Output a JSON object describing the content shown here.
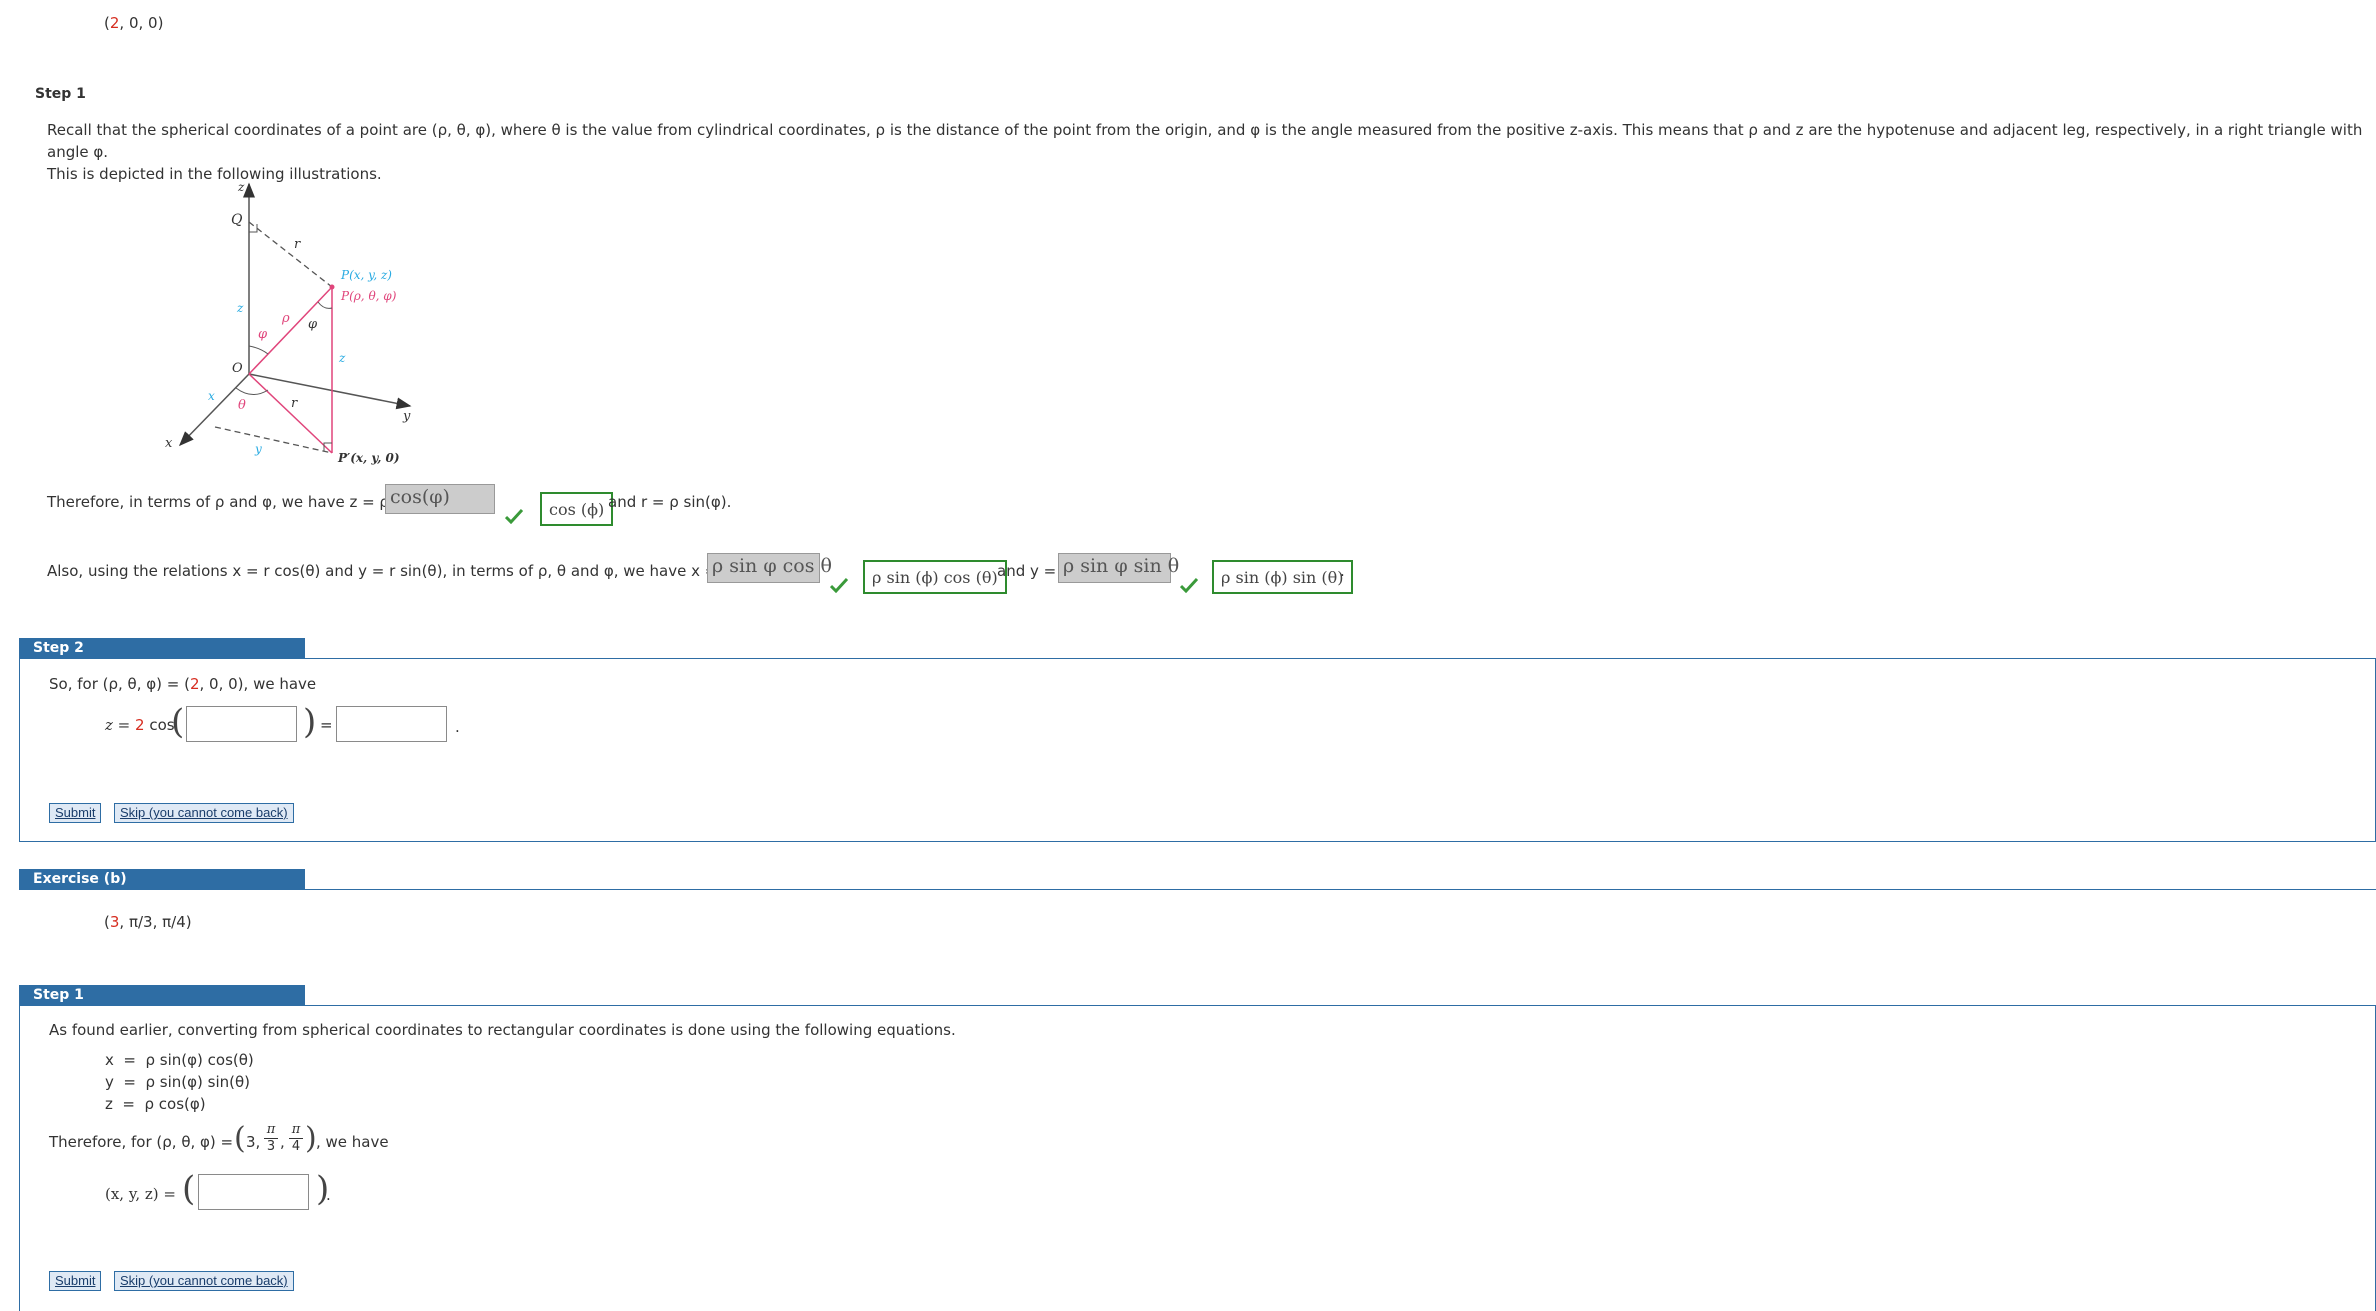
{
  "top_point": {
    "first": "2",
    "rest": ", 0, 0)"
  },
  "step1": {
    "label": "Step 1",
    "para1": "Recall that the spherical coordinates of a point are (ρ, θ, φ), where θ is the value from cylindrical coordinates, ρ is the distance of the point from the origin, and φ is the angle measured from the positive z-axis. This means that ρ and z are the hypotenuse and adjacent leg, respectively, in a right triangle with angle φ.",
    "para2": "This is depicted in the following illustrations.",
    "diagram": {
      "z_axis": "z",
      "Q": "Q",
      "r_top": "r",
      "P_xyz": "P(x, y, z)",
      "P_rho": "P(ρ, θ, φ)",
      "z_left": "z",
      "phi_left": "φ",
      "rho": "ρ",
      "phi_right": "φ",
      "z_right": "z",
      "O": "O",
      "x_small": "x",
      "theta": "θ",
      "r_bottom": "r",
      "y_axis": "y",
      "x_axis": "x",
      "y_small": "y",
      "P_prime": "P′(x, y, 0)"
    },
    "line1": {
      "prefix": "Therefore, in terms of ρ and φ, we have z = ρ",
      "answer": "cos(φ)",
      "correct": "cos (ϕ)",
      "suffix": "and r = ρ sin(φ)."
    },
    "line2": {
      "prefix": "Also, using the relations x = r cos(θ) and y = r sin(θ), in terms of ρ, θ and φ, we have x =",
      "answer_x": "ρ sin φ cos θ",
      "correct_x": "ρ sin (ϕ) cos (θ)",
      "middle": "and y =",
      "answer_y": "ρ sin φ sin θ",
      "correct_y": "ρ sin (ϕ) sin (θ)",
      "end": "."
    }
  },
  "step2": {
    "label": "Step 2",
    "intro_prefix": "So, for (ρ, θ, φ) = (",
    "intro_red": "2",
    "intro_suffix": ", 0, 0), we have",
    "eq_prefix": "z = ",
    "eq_red": "2",
    "eq_func": " cos",
    "equals": "=",
    "period": ".",
    "submit": "Submit",
    "skip": "Skip (you cannot come back)"
  },
  "exercise_b": {
    "label": "Exercise (b)",
    "point_red": "3",
    "point_rest": ", π/3, π/4)"
  },
  "step1b": {
    "label": "Step 1",
    "intro": "As found earlier, converting from spherical coordinates to rectangular coordinates is done using the following equations.",
    "eq_x": "x  =  ρ sin(φ) cos(θ)",
    "eq_y": "y  =  ρ sin(φ) sin(θ)",
    "eq_z": "z  =  ρ cos(φ)",
    "therefore_prefix": "Therefore, for (ρ, θ, φ) = ",
    "val_red": "3,",
    "frac1_num": "π",
    "frac1_den": "3",
    "frac2_num": "π",
    "frac2_den": "4",
    "therefore_suffix": ", we have",
    "xyz_label": "(x, y, z) =",
    "period": ".",
    "submit": "Submit",
    "skip": "Skip (you cannot come back)"
  },
  "colors": {
    "accent": "#2e6da4",
    "red": "#d62d20",
    "correct": "#2e8b2e",
    "pink": "#e0457b",
    "cyan": "#29abe2"
  }
}
